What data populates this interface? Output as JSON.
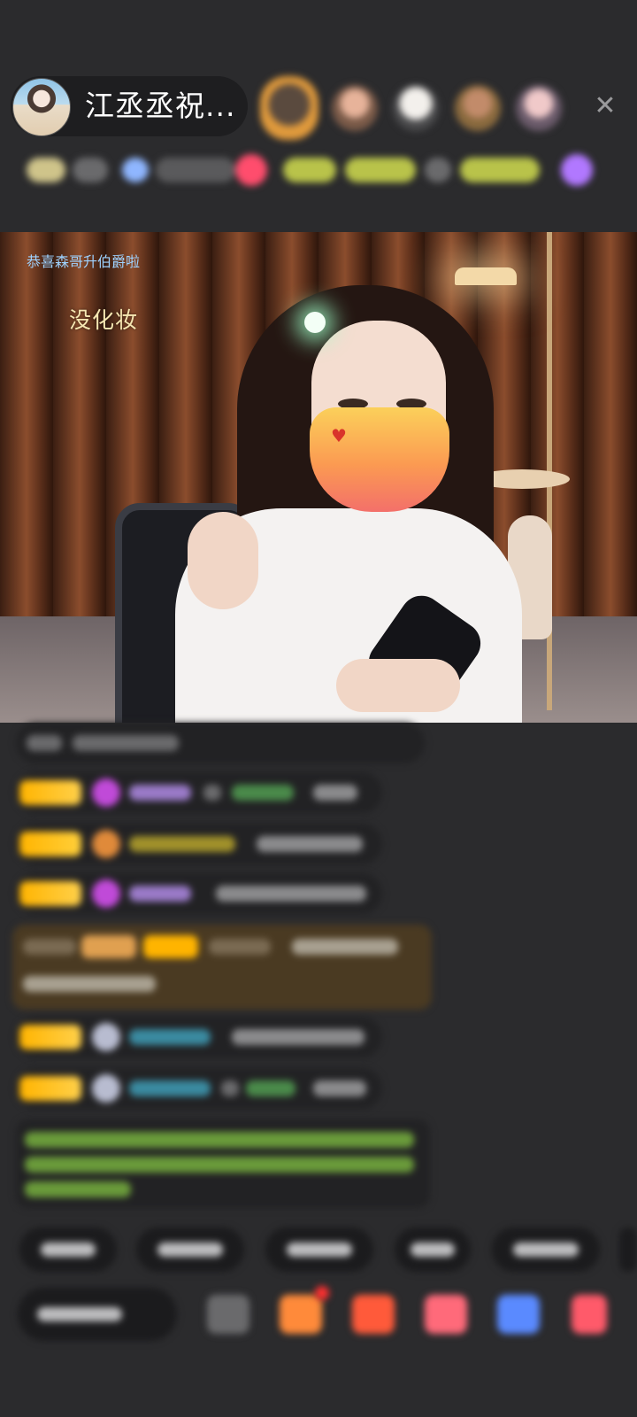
{
  "header": {
    "host_name": "江丞丞祝...",
    "close_symbol": "✕",
    "viewers": [
      "viewer-1",
      "viewer-2",
      "viewer-3",
      "viewer-4",
      "viewer-5"
    ]
  },
  "video": {
    "promo_text": "恭喜森哥升伯爵啦",
    "overlay_text": "没化妆"
  },
  "icons": {
    "close": "close-icon",
    "emoji": "emoji-icon",
    "gift": "gift-icon"
  },
  "colors": {
    "background": "#2b2b2d",
    "accent_gold": "#ffb400",
    "promo_blue": "#9ed2ff",
    "overlay_cream": "#f6e7b2"
  }
}
